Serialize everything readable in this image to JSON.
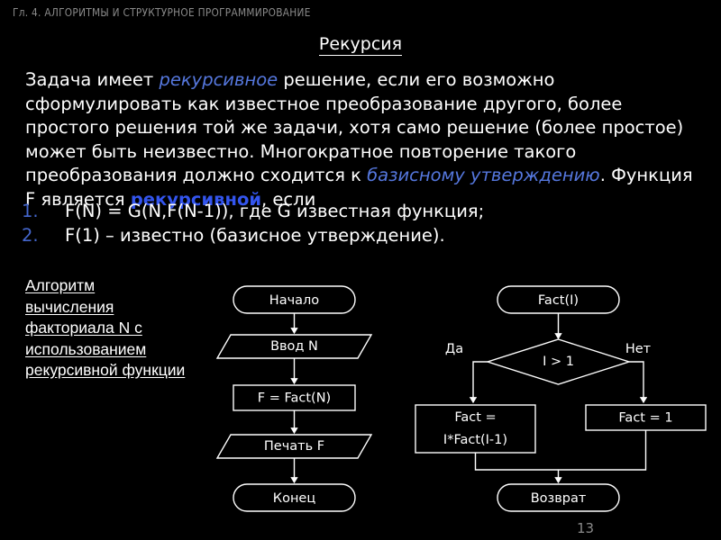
{
  "header": {
    "chapter": "Гл. 4. АЛГОРИТМЫ И СТРУКТУРНОЕ ПРОГРАММИРОВАНИЕ",
    "title": "Рекурсия"
  },
  "body": {
    "para_1": "Задача имеет ",
    "emphasis_1": "рекурсивное",
    "para_2": " решение, если его возможно сформулировать как известное преобразование другого, более простого решения той же задачи, хотя само решение (более простое) может быть неизвестно. Многократное повторение такого преобразования должно сходится к ",
    "emphasis_2": "базисному утверждению",
    "para_3": ". Функция F является ",
    "emphasis_3": "рекурсивной",
    "para_4": ", если"
  },
  "list": [
    {
      "marker": "1.",
      "text": "F(N) = G(N,F(N-1)), где G известная функция;"
    },
    {
      "marker": "2.",
      "text": "F(1) – известно (базисное утверждение)."
    }
  ],
  "caption": {
    "text": "Алгоритм вычисления факториала N с использованием рекурсивной функции"
  },
  "flowchart_left": {
    "start": "Начало",
    "input": "Ввод N",
    "process": "F = Fact(N)",
    "output": "Печать F",
    "end": "Конец"
  },
  "flowchart_right": {
    "entry": "Fact(I)",
    "condition": "I > 1",
    "label_yes": "Да",
    "label_no": "Нет",
    "branch_true_line1": "Fact =",
    "branch_true_line2": "I*Fact(I-1)",
    "branch_false": "Fact = 1",
    "return": "Возврат"
  },
  "footer": {
    "page_number": "13"
  },
  "colors": {
    "background": "#000000",
    "text": "#ffffff",
    "header_gray": "#8a8a8a",
    "accent_italic": "#5577dd",
    "accent_bold": "#3355ee",
    "list_marker": "#4466cc"
  }
}
